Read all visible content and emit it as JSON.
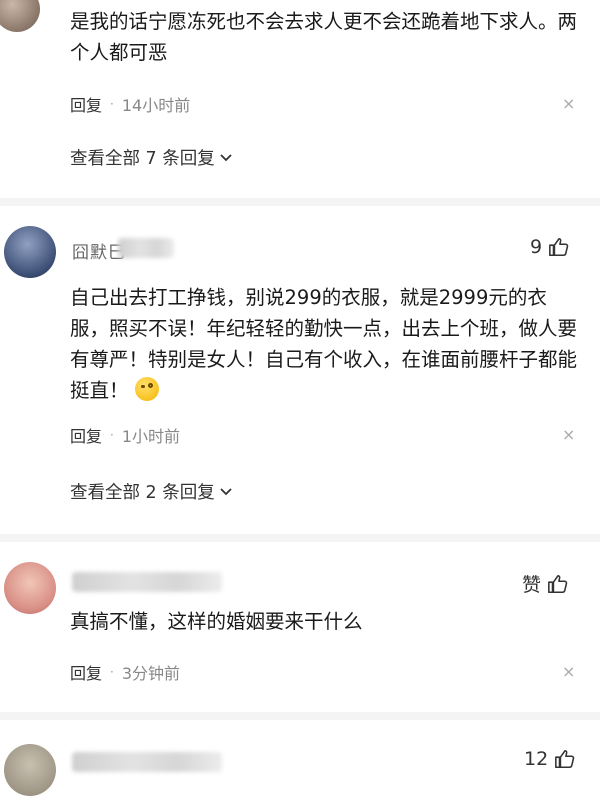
{
  "comments": [
    {
      "text": "是我的话宁愿冻死也不会去求人更不会还跪着地下求人。两个人都可恶",
      "reply_label": "回复",
      "separator": "·",
      "time": "14小时前",
      "close_glyph": "×",
      "view_all": "查看全部 7 条回复"
    },
    {
      "name_partial": "囧默巳",
      "likes": "9",
      "text": "自己出去打工挣钱，别说299的衣服，就是2999元的衣服，照买不误！年纪轻轻的勤快一点，出去上个班，做人要有尊严！特别是女人！自己有个收入，在谁面前腰杆子都能挺直！",
      "reply_label": "回复",
      "separator": "·",
      "time": "1小时前",
      "close_glyph": "×",
      "view_all": "查看全部 2 条回复"
    },
    {
      "likes": "赞",
      "text": "真搞不懂，这样的婚姻要来干什么",
      "reply_label": "回复",
      "separator": "·",
      "time": "3分钟前",
      "close_glyph": "×"
    },
    {
      "likes": "12"
    }
  ],
  "icons": {
    "like": "thumb-up-icon",
    "chevron": "chevron-down-icon",
    "close": "close-icon",
    "emoji": "cool-face-emoji-icon"
  }
}
